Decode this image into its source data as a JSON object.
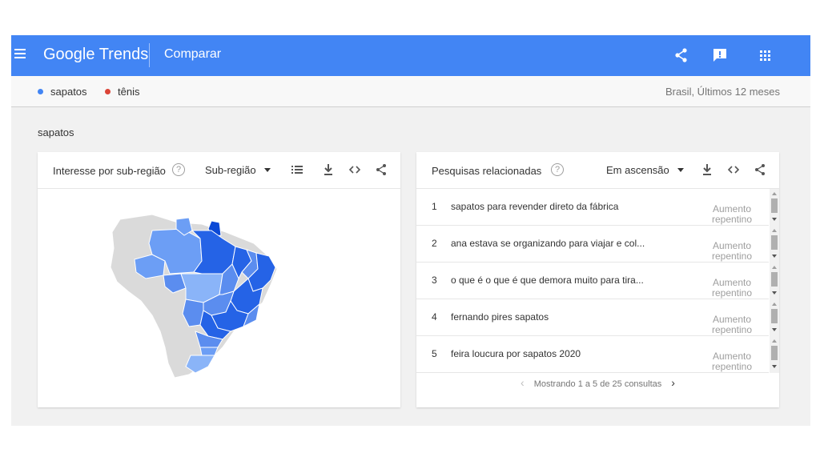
{
  "header": {
    "brand": "Google Trends",
    "compare_label": "Comparar",
    "icons": [
      "menu-icon",
      "share-icon",
      "feedback-icon",
      "apps-icon"
    ]
  },
  "terms": [
    {
      "label": "sapatos",
      "color": "#4285f4"
    },
    {
      "label": "tênis",
      "color": "#db4437"
    }
  ],
  "scope": "Brasil, Últimos 12 meses",
  "section_label": "sapatos",
  "region_card": {
    "title": "Interesse por sub-região",
    "dropdown": "Sub-região",
    "icons": [
      "help-icon",
      "list-icon",
      "download-icon",
      "embed-icon",
      "share-icon"
    ]
  },
  "related_card": {
    "title": "Pesquisas relacionadas",
    "dropdown": "Em ascensão",
    "icons": [
      "help-icon",
      "download-icon",
      "embed-icon",
      "share-icon"
    ],
    "rows": [
      {
        "rank": "1",
        "query": "sapatos para revender direto da fábrica",
        "badge": "Aumento repentino"
      },
      {
        "rank": "2",
        "query": "ana estava se organizando para viajar e col...",
        "badge": "Aumento repentino"
      },
      {
        "rank": "3",
        "query": "o que é o que é que demora muito para tira...",
        "badge": "Aumento repentino"
      },
      {
        "rank": "4",
        "query": "fernando pires sapatos",
        "badge": "Aumento repentino"
      },
      {
        "rank": "5",
        "query": "feira loucura por sapatos 2020",
        "badge": "Aumento repentino"
      }
    ],
    "pager_text": "Mostrando 1 a 5 de 25 consultas",
    "pager_prev": "‹",
    "pager_next": "›"
  },
  "colors": {
    "header_bg": "#4285f4",
    "map_light": "#8ab4f8",
    "map_mid": "#5b8def",
    "map_dark": "#2563e6",
    "map_darkest": "#0b49d6",
    "map_gray": "#dadada"
  }
}
